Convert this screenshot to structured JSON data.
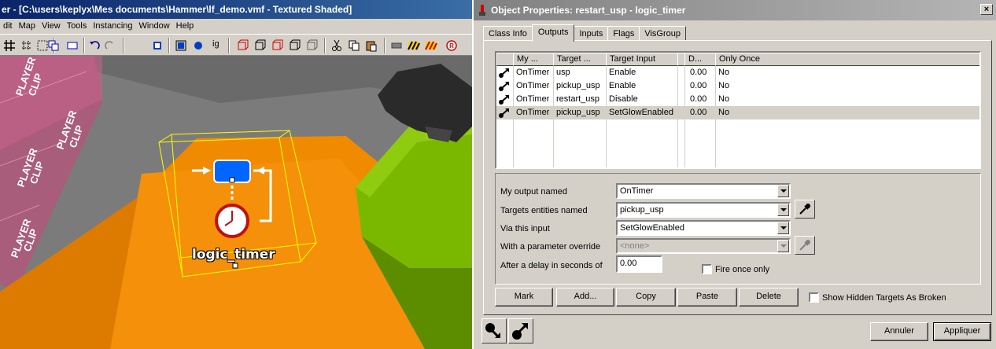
{
  "hammer": {
    "title": "er - [C:\\users\\keplyx\\Mes documents\\Hammer\\lf_demo.vmf - Textured Shaded]",
    "menu": [
      "dit",
      "Map",
      "View",
      "Tools",
      "Instancing",
      "Window",
      "Help"
    ],
    "entity_label": "logic_timer",
    "clip_labels": [
      "PLAYER\nCLIP",
      "PLAYER\nCLIP",
      "PLAYER\nCLIP",
      "PLAYER\nCLIP"
    ],
    "colors": {
      "floor": "#f08a00",
      "clip": "#b0587a",
      "box": "#7ab800",
      "selection": "#ffff00"
    }
  },
  "dialog": {
    "title": "Object Properties: restart_usp - logic_timer",
    "tabs": [
      "Class Info",
      "Outputs",
      "Inputs",
      "Flags",
      "VisGroup"
    ],
    "active_tab": "Outputs",
    "columns": [
      "My ...",
      "Target ...",
      "Target Input",
      "D...",
      "Only Once"
    ],
    "rows": [
      {
        "output": "OnTimer",
        "target": "usp",
        "input": "Enable",
        "delay": "0.00",
        "once": "No"
      },
      {
        "output": "OnTimer",
        "target": "pickup_usp",
        "input": "Enable",
        "delay": "0.00",
        "once": "No"
      },
      {
        "output": "OnTimer",
        "target": "restart_usp",
        "input": "Disable",
        "delay": "0.00",
        "once": "No"
      },
      {
        "output": "OnTimer",
        "target": "pickup_usp",
        "input": "SetGlowEnabled",
        "delay": "0.00",
        "once": "No"
      }
    ],
    "selected_row": 3,
    "form": {
      "output_label": "My output named",
      "output_value": "OnTimer",
      "targets_label": "Targets entities named",
      "targets_value": "pickup_usp",
      "input_label": "Via this input",
      "input_value": "SetGlowEnabled",
      "param_label": "With a parameter override",
      "param_value": "<none>",
      "delay_label": "After a delay in seconds of",
      "delay_value": "0.00",
      "fire_once_label": "Fire once only"
    },
    "buttons": {
      "mark": "Mark",
      "add": "Add...",
      "copy": "Copy",
      "paste": "Paste",
      "delete": "Delete",
      "show_hidden": "Show Hidden Targets As Broken",
      "cancel": "Annuler",
      "apply": "Appliquer"
    }
  }
}
